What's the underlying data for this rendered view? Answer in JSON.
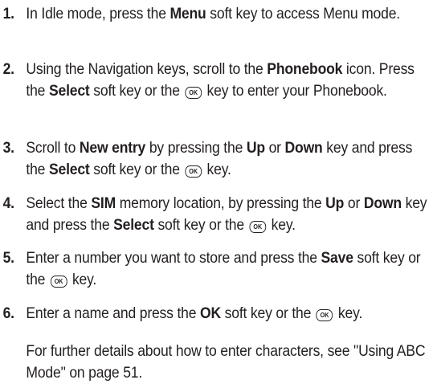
{
  "steps": [
    {
      "number": "1.",
      "t1": "In Idle mode, press the ",
      "b1": "Menu",
      "t2": " soft key to access Menu mode."
    },
    {
      "number": "2.",
      "t1": "Using the Navigation keys, scroll to the ",
      "b1": "Phonebook",
      "t2": " icon. Press the ",
      "b2": "Select",
      "t3": " soft key or the ",
      "t4": " key to enter your Phonebook."
    },
    {
      "number": "3.",
      "t1": "Scroll to ",
      "b1": "New entry",
      "t2": " by pressing the ",
      "b2": "Up",
      "t3": " or ",
      "b3": "Down",
      "t4": " key and press the ",
      "b4": "Select",
      "t5": " soft key or the ",
      "t6": " key."
    },
    {
      "number": "4.",
      "t1": "Select the ",
      "b1": "SIM",
      "t2": " memory location, by pressing the ",
      "b2": "Up",
      "t3": " or ",
      "b3": "Down",
      "t4": " key and press the ",
      "b4": "Select",
      "t5": " soft key or the ",
      "t6": " key."
    },
    {
      "number": "5.",
      "t1": "Enter a number you want to store and press the ",
      "b1": "Save",
      "t2": " soft key or the ",
      "t3": " key."
    },
    {
      "number": "6.",
      "t1": "Enter a name and press the ",
      "b1": "OK",
      "t2": " soft key or the ",
      "t3": " key."
    }
  ],
  "ok_key_label": "OK",
  "note": "For further details about how to enter characters, see \"Using ABC Mode\" on page 51."
}
